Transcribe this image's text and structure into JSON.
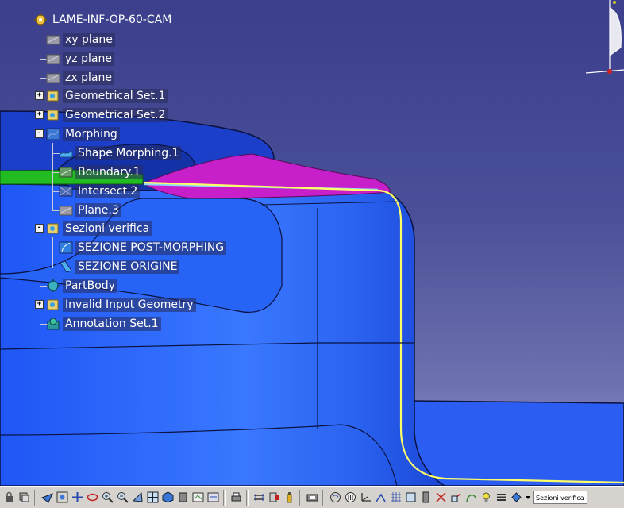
{
  "tree": {
    "root": "LAME-INF-OP-60-CAM",
    "items": [
      {
        "label": "xy plane",
        "icon": "plane-icon"
      },
      {
        "label": "yz plane",
        "icon": "plane-icon"
      },
      {
        "label": "zx plane",
        "icon": "plane-icon"
      },
      {
        "label": "Geometrical Set.1",
        "icon": "geometrical-set-icon",
        "expander": "+"
      },
      {
        "label": "Geometrical Set.2",
        "icon": "geometrical-set-icon",
        "expander": "+"
      },
      {
        "label": "Morphing",
        "icon": "geometrical-set-icon",
        "expander": "-"
      },
      {
        "label": "Shape Morphing.1",
        "icon": "shape-morphing-icon"
      },
      {
        "label": "Boundary.1",
        "icon": "boundary-icon"
      },
      {
        "label": "Intersect.2",
        "icon": "intersect-icon"
      },
      {
        "label": "Plane.3",
        "icon": "plane-icon"
      },
      {
        "label": "Sezioni verifica",
        "icon": "geometrical-set-icon",
        "expander": "-"
      },
      {
        "label": "SEZIONE POST-MORPHING",
        "icon": "section-icon"
      },
      {
        "label": "SEZIONE ORIGINE",
        "icon": "section-icon"
      },
      {
        "label": "PartBody",
        "icon": "partbody-icon"
      },
      {
        "label": "Invalid Input Geometry",
        "icon": "geometrical-set-icon",
        "expander": "+"
      },
      {
        "label": "Annotation Set.1",
        "icon": "annotation-set-icon"
      }
    ]
  },
  "toolbar": {
    "selection_value": "Sezioni verifica"
  },
  "colors": {
    "background_top": "#3b3f8c",
    "part_surface": "#2f6fff",
    "highlight_magenta": "#c71fc9",
    "curve_yellow": "#ffff66",
    "boundary_green": "#22bb22"
  }
}
